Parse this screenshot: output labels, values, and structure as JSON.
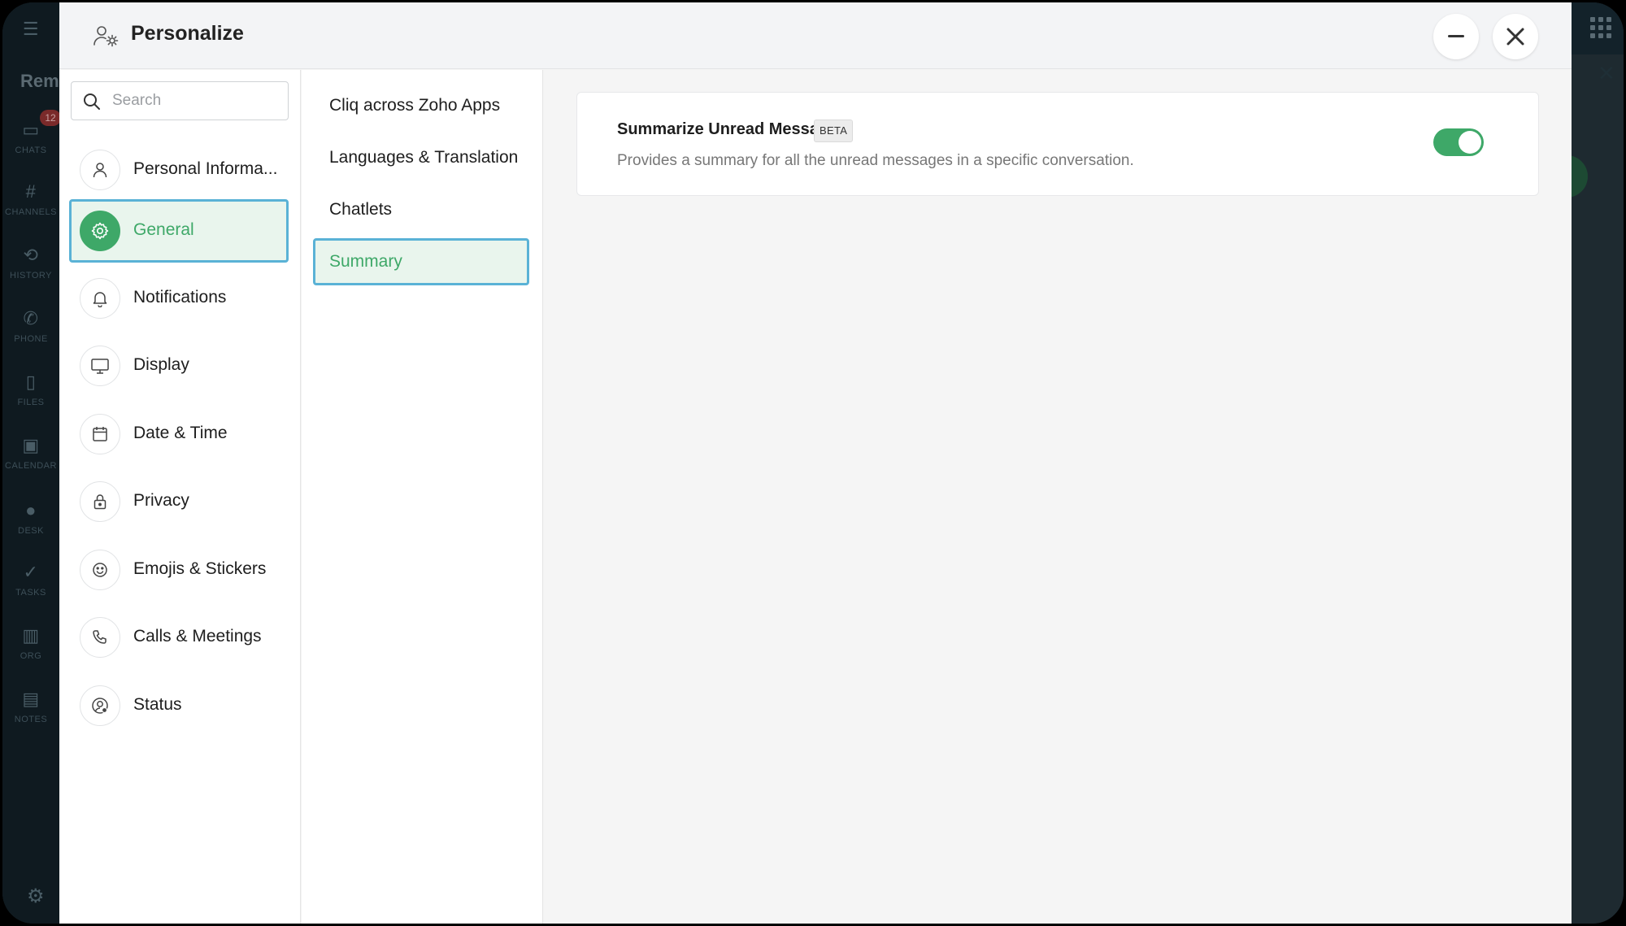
{
  "background_app": {
    "title": "Rem",
    "chats_badge": "12",
    "rail": [
      "CHATS",
      "CHANNELS",
      "HISTORY",
      "PHONE",
      "FILES",
      "CALENDAR",
      "DESK",
      "TASKS",
      "ORG",
      "NOTES"
    ]
  },
  "modal": {
    "title": "Personalize",
    "minimize_icon": "minus-icon",
    "close_icon": "close-icon"
  },
  "search": {
    "placeholder": "Search",
    "value": ""
  },
  "nav": {
    "items": [
      {
        "label": "Personal Informa...",
        "icon": "user-icon"
      },
      {
        "label": "General",
        "icon": "gear-icon",
        "active": true
      },
      {
        "label": "Notifications",
        "icon": "bell-icon"
      },
      {
        "label": "Display",
        "icon": "monitor-icon"
      },
      {
        "label": "Date & Time",
        "icon": "calendar-icon"
      },
      {
        "label": "Privacy",
        "icon": "lock-icon"
      },
      {
        "label": "Emojis & Stickers",
        "icon": "smiley-icon"
      },
      {
        "label": "Calls & Meetings",
        "icon": "phone-icon"
      },
      {
        "label": "Status",
        "icon": "user-status-icon"
      }
    ]
  },
  "subnav": {
    "items": [
      {
        "label": "Cliq across Zoho Apps"
      },
      {
        "label": "Languages & Translation"
      },
      {
        "label": "Chatlets"
      },
      {
        "label": "Summary",
        "active": true
      }
    ]
  },
  "content": {
    "card": {
      "title": "Summarize Unread Messages",
      "badge": "BETA",
      "description": "Provides a summary for all the unread messages in a specific conversation.",
      "toggle_on": true
    }
  },
  "colors": {
    "accent": "#3ea868",
    "selection_border": "#5ab2d6",
    "selection_bg": "#e9f5ed"
  }
}
